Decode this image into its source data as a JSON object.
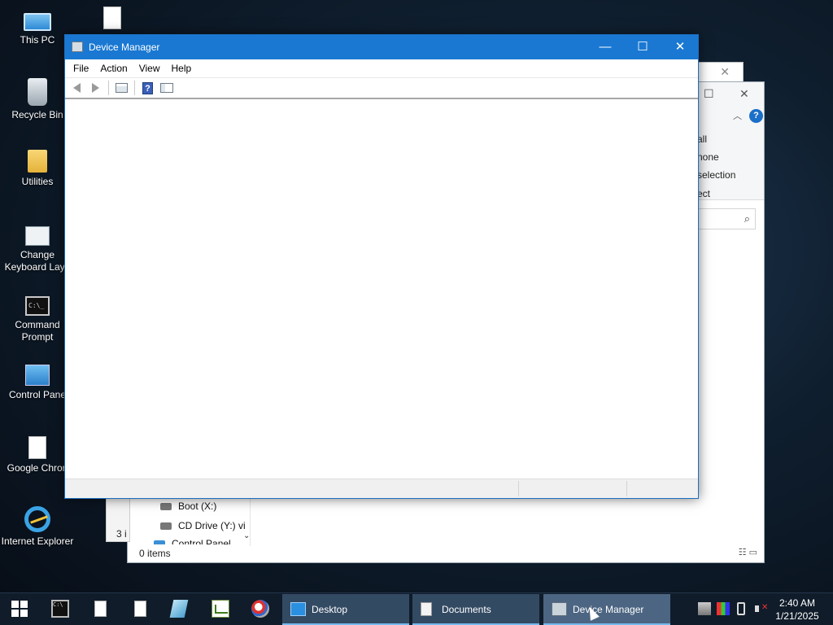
{
  "desktop": {
    "icons": [
      {
        "label": "This PC",
        "icon": "computer-icon"
      },
      {
        "label": "",
        "icon": "blank-file-icon"
      },
      {
        "label": "Recycle Bin",
        "icon": "recycle-bin-icon"
      },
      {
        "label": "Utilities",
        "icon": "folder-icon"
      },
      {
        "label": "Change\nKeyboard Layo",
        "icon": "keyboard-settings-icon"
      },
      {
        "label": "Command\nPrompt",
        "icon": "command-prompt-icon"
      },
      {
        "label": "Control Pane",
        "icon": "control-panel-icon"
      },
      {
        "label": "Google Chron",
        "icon": "document-icon"
      },
      {
        "label": "Internet Explorer",
        "icon": "internet-explorer-icon"
      }
    ]
  },
  "background_window": {
    "ribbon_items": [
      "all",
      "none",
      "selection",
      "ect"
    ],
    "tree_items": [
      "Boot (X:)",
      "CD Drive (Y:) vi",
      "Control Panel"
    ],
    "status": "0 items",
    "partial_text": "3 i"
  },
  "device_manager": {
    "title": "Device Manager",
    "menu": [
      "File",
      "Action",
      "View",
      "Help"
    ],
    "toolbar": [
      "back-icon",
      "forward-icon",
      "properties-icon",
      "help-icon",
      "show-hide-console-tree-icon"
    ],
    "help_glyph": "?"
  },
  "taskbar": {
    "pinned": [
      "start-icon",
      "command-prompt-icon",
      "document-icon",
      "document-icon",
      "notepad-icon",
      "spreadsheet-icon",
      "paint-icon"
    ],
    "buttons": [
      {
        "label": "Desktop",
        "active": false
      },
      {
        "label": "Documents",
        "active": false
      },
      {
        "label": "Device Manager",
        "active": true
      }
    ],
    "clock": {
      "time": "2:40 AM",
      "date": "1/21/2025"
    }
  },
  "colors": {
    "titlebar": "#1a78d2",
    "accent": "#76b9ed",
    "taskbar": "#101c2a"
  }
}
